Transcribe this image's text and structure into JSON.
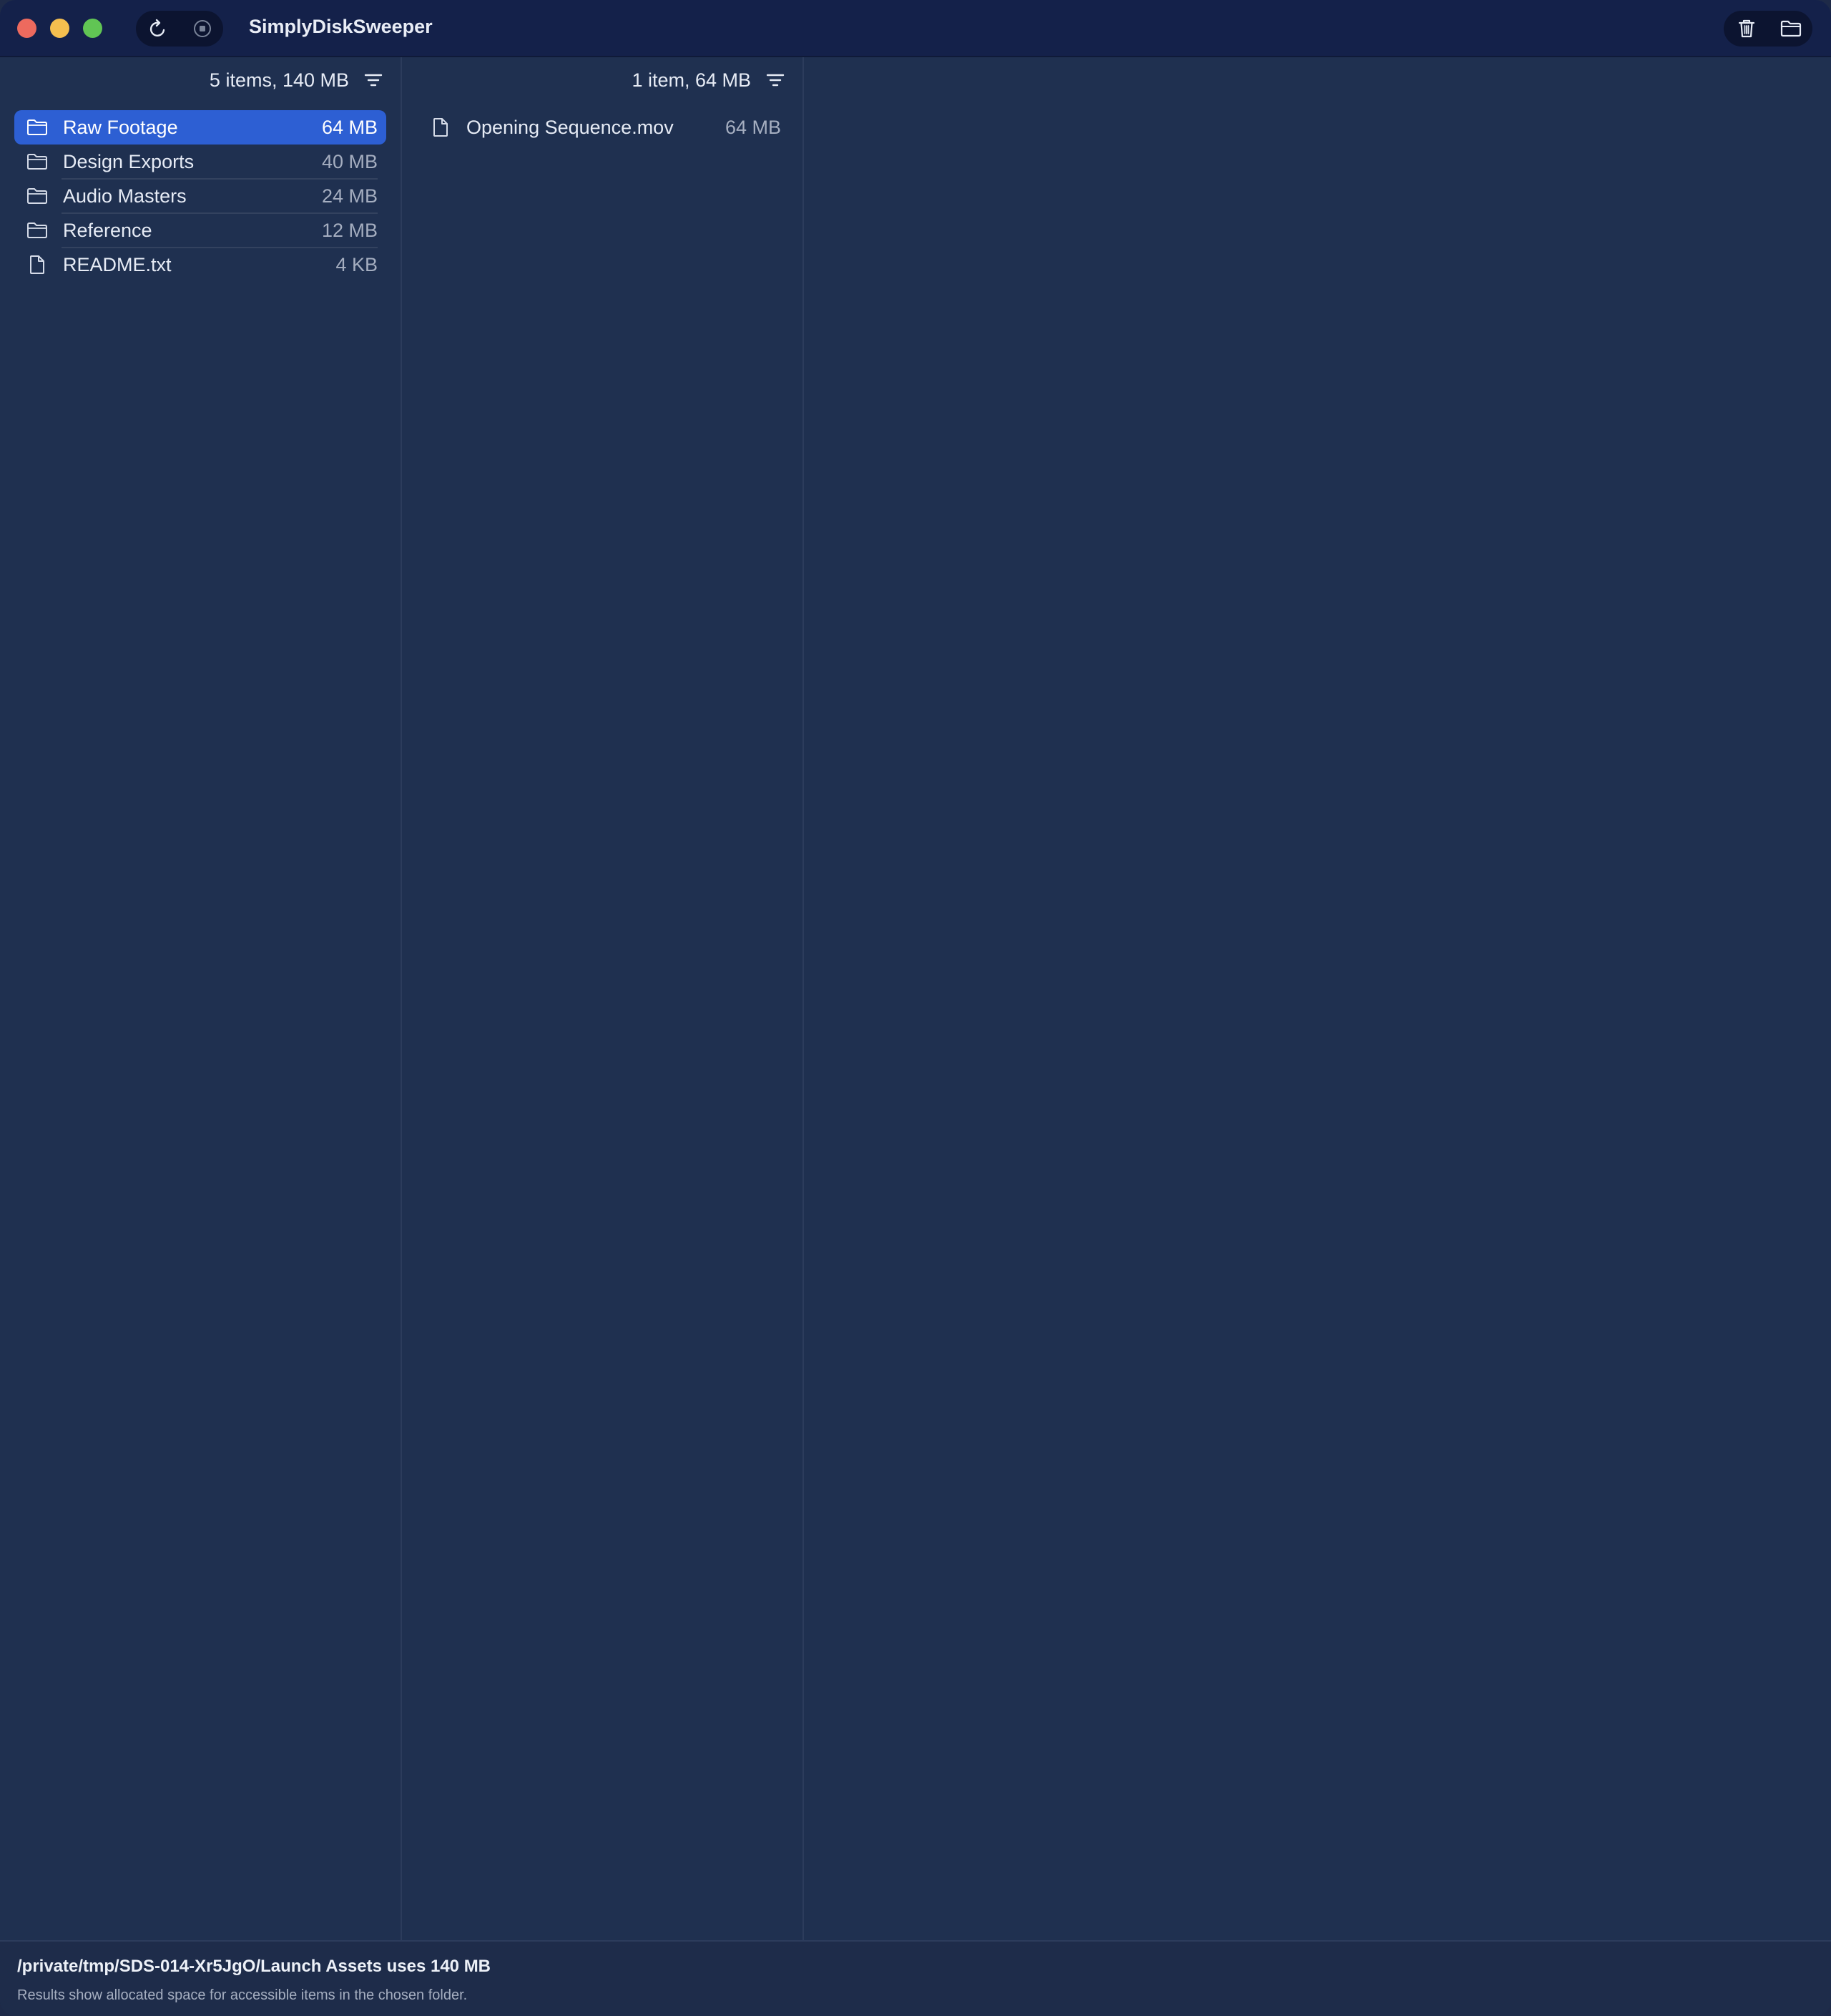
{
  "window": {
    "title": "SimplyDiskSweeper",
    "traffic_lights": {
      "close_color": "#ed6a5e",
      "minimize_color": "#f5bf4f",
      "maximize_color": "#61c554"
    }
  },
  "toolbar": {
    "left_buttons": [
      {
        "name": "refresh",
        "icon": "refresh-icon"
      },
      {
        "name": "stop",
        "icon": "stop-icon"
      }
    ],
    "right_buttons": [
      {
        "name": "delete",
        "icon": "trash-icon"
      },
      {
        "name": "choose-folder",
        "icon": "folder-icon"
      }
    ]
  },
  "columns": [
    {
      "summary": "5 items, 140 MB",
      "sort_icon": "sort-icon",
      "items": [
        {
          "name": "Raw Footage",
          "size": "64 MB",
          "type": "folder",
          "selected": true
        },
        {
          "name": "Design Exports",
          "size": "40 MB",
          "type": "folder",
          "selected": false
        },
        {
          "name": "Audio Masters",
          "size": "24 MB",
          "type": "folder",
          "selected": false
        },
        {
          "name": "Reference",
          "size": "12 MB",
          "type": "folder",
          "selected": false
        },
        {
          "name": "README.txt",
          "size": "4 KB",
          "type": "file",
          "selected": false
        }
      ]
    },
    {
      "summary": "1 item, 64 MB",
      "sort_icon": "sort-icon",
      "items": [
        {
          "name": "Opening Sequence.mov",
          "size": "64 MB",
          "type": "file",
          "selected": false
        }
      ]
    }
  ],
  "status": {
    "main": "/private/tmp/SDS-014-Xr5JgO/Launch Assets uses 140 MB",
    "sub": "Results show allocated space for accessible items in the chosen folder."
  },
  "colors": {
    "window_background": "#1f3050",
    "titlebar_background": "#14214a",
    "selection_accent": "#2d5fd3",
    "primary_text": "#e6ebf5",
    "secondary_text": "#a5aec0"
  }
}
